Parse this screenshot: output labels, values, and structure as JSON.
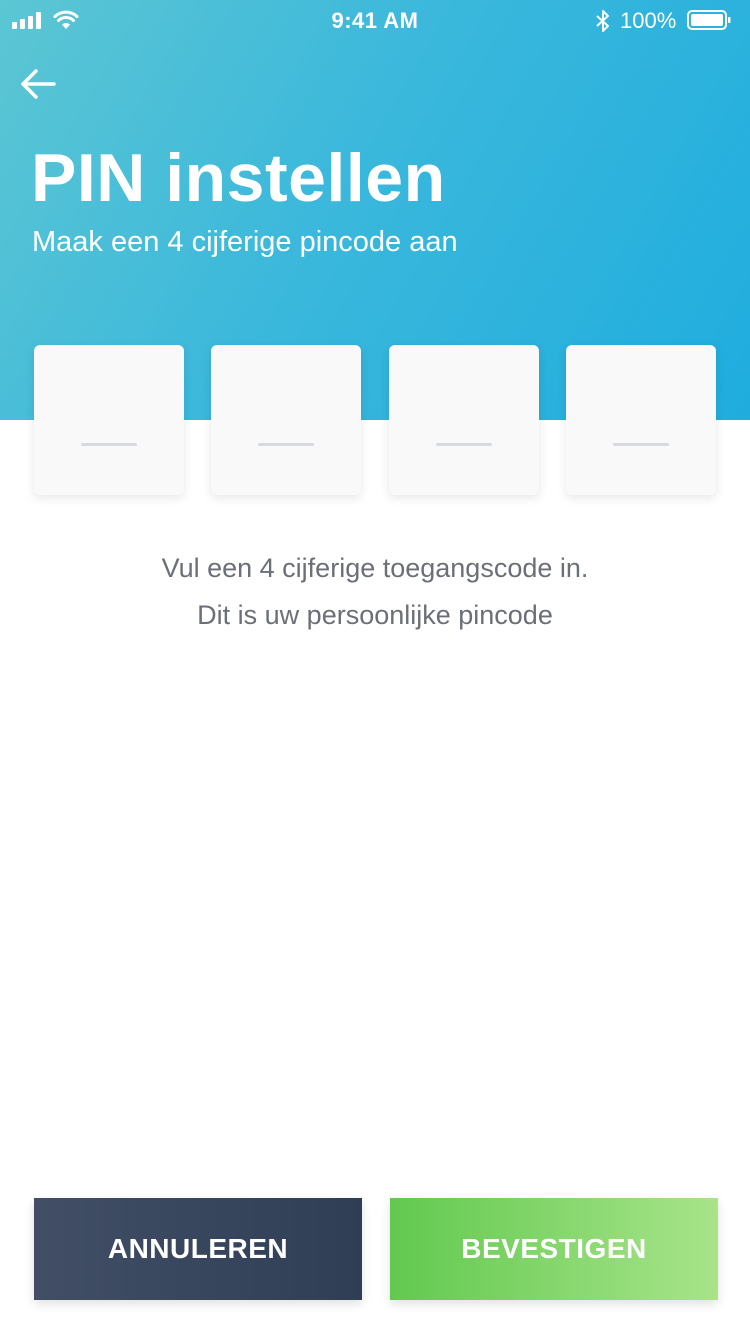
{
  "status_bar": {
    "time": "9:41 AM",
    "battery": "100%",
    "icons": [
      "signal-icon",
      "wifi-icon",
      "bluetooth-icon",
      "battery-icon"
    ]
  },
  "header": {
    "back_icon": "arrow-left-icon",
    "title": "PIN instellen",
    "subtitle": "Maak een 4 cijferige pincode aan"
  },
  "pin": {
    "digits": 4,
    "placeholder_char": "—"
  },
  "info": {
    "line1": "Vul een 4 cijferige toegangscode in.",
    "line2": "Dit is uw persoonlijke pincode"
  },
  "actions": {
    "cancel_label": "ANNULEREN",
    "confirm_label": "BEVESTIGEN"
  },
  "colors": {
    "header_gradient_start": "#5cc6d3",
    "header_gradient_end": "#1fadde",
    "cancel_bg": "#3a475e",
    "confirm_gradient_start": "#62c94f",
    "confirm_gradient_end": "#a8e48a",
    "info_text": "#6b6f78"
  }
}
